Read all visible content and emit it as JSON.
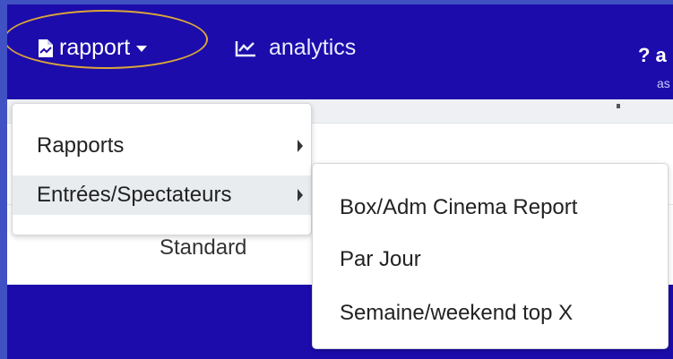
{
  "navbar": {
    "items": [
      {
        "label": "rapport",
        "icon": "file-chart-icon",
        "has_dropdown": true
      },
      {
        "label": "analytics",
        "icon": "line-chart-icon"
      }
    ],
    "help": {
      "label": "? a",
      "sublabel": "as"
    }
  },
  "content": {
    "standard_label": "Standard"
  },
  "dropdown": {
    "items": [
      {
        "label": "Rapports",
        "has_submenu": true
      },
      {
        "label": "Entrées/Spectateurs",
        "has_submenu": true,
        "active": true
      }
    ]
  },
  "submenu": {
    "items": [
      {
        "label": "Box/Adm Cinema Report"
      },
      {
        "label": "Par Jour"
      },
      {
        "label": "Semaine/weekend top X"
      }
    ]
  },
  "colors": {
    "navbar": "#1c0cab",
    "frame": "#3f51c3",
    "highlight_ring": "#d9a53a",
    "hover_bg": "#e9ecef"
  }
}
